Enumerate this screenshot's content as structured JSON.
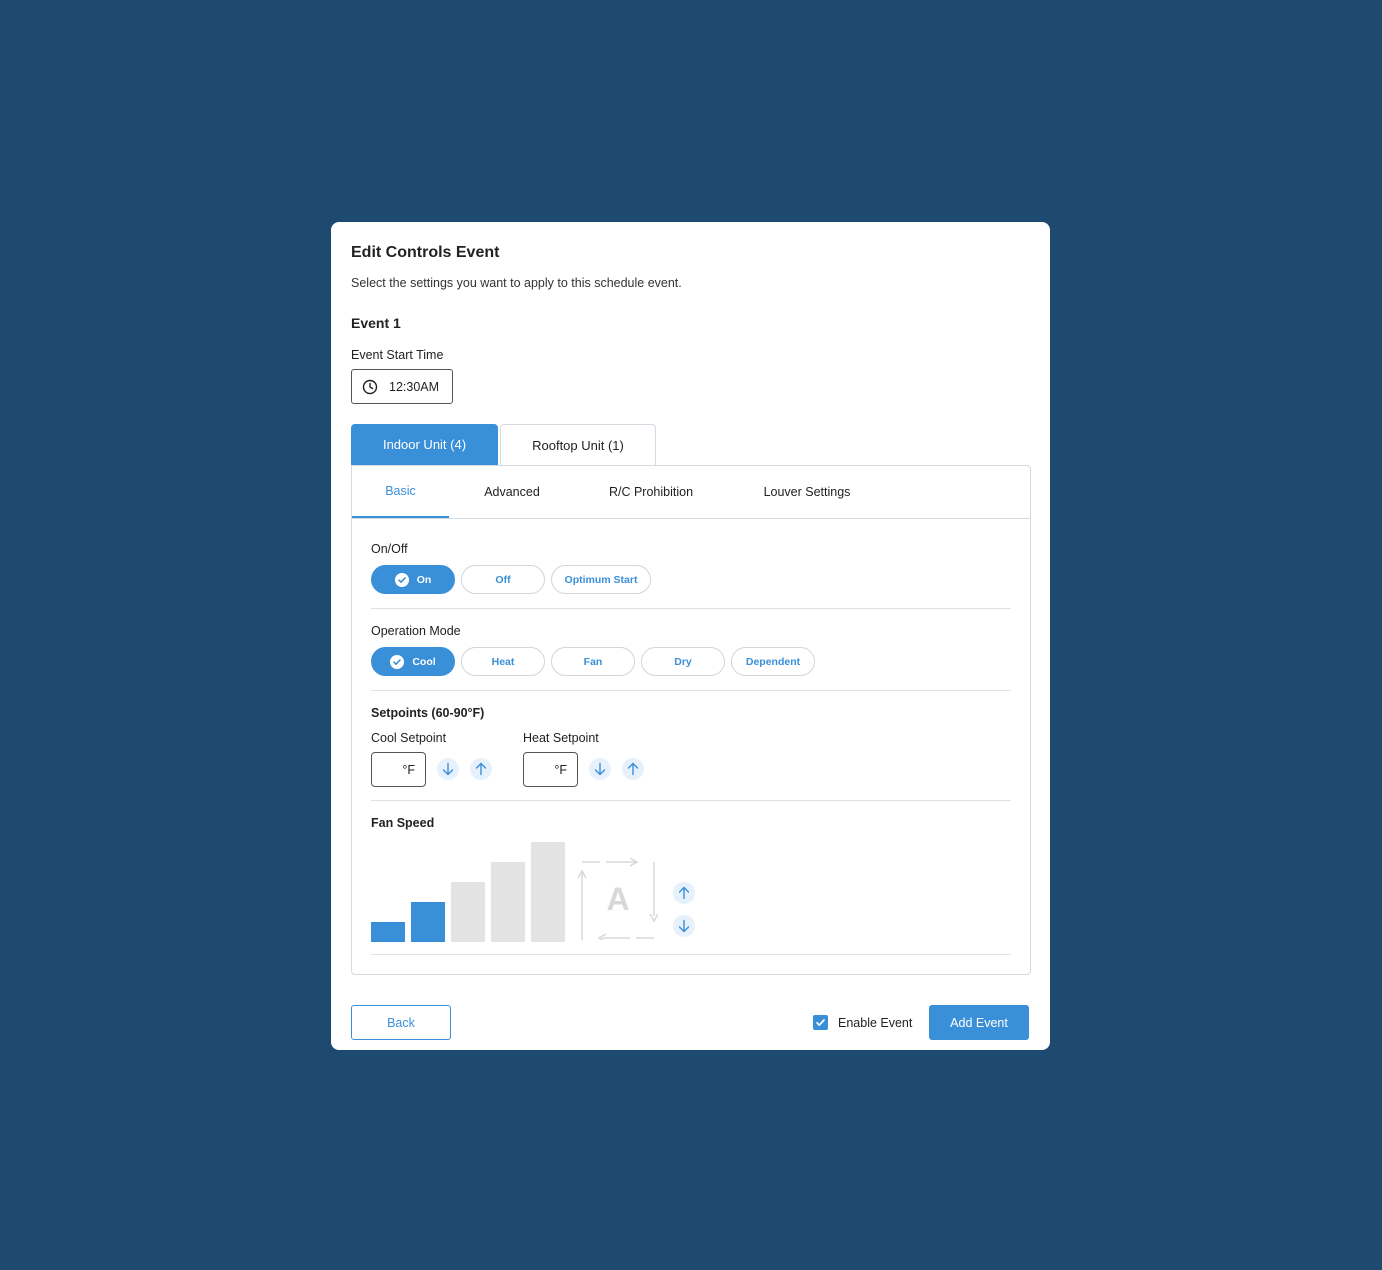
{
  "modal": {
    "title": "Edit Controls Event",
    "subtitle": "Select the settings you want to apply to this schedule event."
  },
  "event": {
    "heading": "Event 1",
    "start_time_label": "Event Start Time",
    "start_time_value": "12:30AM"
  },
  "unit_tabs": [
    {
      "label": "Indoor Unit (4)",
      "active": true
    },
    {
      "label": "Rooftop Unit (1)",
      "active": false
    }
  ],
  "sub_tabs": [
    {
      "label": "Basic",
      "active": true
    },
    {
      "label": "Advanced",
      "active": false
    },
    {
      "label": "R/C Prohibition",
      "active": false
    },
    {
      "label": "Louver Settings",
      "active": false
    }
  ],
  "on_off": {
    "label": "On/Off",
    "options": [
      {
        "label": "On",
        "selected": true
      },
      {
        "label": "Off",
        "selected": false
      },
      {
        "label": "Optimum Start",
        "selected": false
      }
    ]
  },
  "operation_mode": {
    "label": "Operation Mode",
    "options": [
      {
        "label": "Cool",
        "selected": true
      },
      {
        "label": "Heat",
        "selected": false
      },
      {
        "label": "Fan",
        "selected": false
      },
      {
        "label": "Dry",
        "selected": false
      },
      {
        "label": "Dependent",
        "selected": false
      }
    ]
  },
  "setpoints": {
    "label": "Setpoints (60-90°F)",
    "cool_label": "Cool Setpoint",
    "cool_unit": "°F",
    "heat_label": "Heat Setpoint",
    "heat_unit": "°F"
  },
  "fan_speed": {
    "label": "Fan Speed",
    "levels": 5,
    "selected_level": 2,
    "auto_label": "A"
  },
  "footer": {
    "back_label": "Back",
    "enable_label": "Enable Event",
    "enable_checked": true,
    "add_label": "Add Event"
  },
  "colors": {
    "background": "#1f4a70",
    "accent": "#3a8fd9",
    "inactive_bar": "#e3e3e3"
  }
}
